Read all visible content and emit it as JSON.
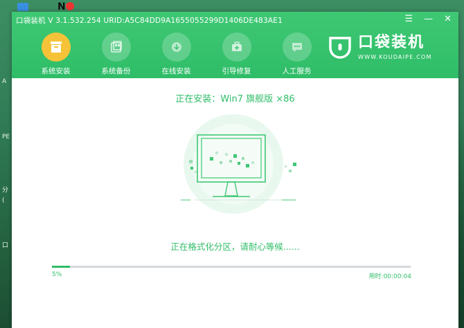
{
  "desktop": {
    "left_glyphs": [
      "A",
      "PE",
      "分",
      "(",
      "口"
    ]
  },
  "window": {
    "title": "口袋装机 V 3.1.532.254 URID:A5C84DD9A1655055299D1406DE483AE1",
    "controls": {
      "menu": "☰",
      "minimize": "—",
      "close": "✕"
    }
  },
  "nav": {
    "items": [
      {
        "label": "系统安装",
        "icon": "system-install-icon",
        "active": true
      },
      {
        "label": "系统备份",
        "icon": "system-backup-icon",
        "active": false
      },
      {
        "label": "在线安装",
        "icon": "online-install-icon",
        "active": false
      },
      {
        "label": "引导修复",
        "icon": "boot-repair-icon",
        "active": false
      },
      {
        "label": "人工服务",
        "icon": "chat-service-icon",
        "active": false
      }
    ]
  },
  "logo": {
    "name": "口袋装机",
    "url": "WWW.KOUDAIPE.COM"
  },
  "install": {
    "title": "正在安装：Win7 旗舰版 ×86",
    "status": "正在格式化分区，请耐心等候......",
    "progress_percent": 5,
    "progress_label": "5%",
    "elapsed_label": "用时:00:00:04"
  },
  "colors": {
    "accent": "#2fbd68",
    "active_nav": "#f6c338"
  }
}
